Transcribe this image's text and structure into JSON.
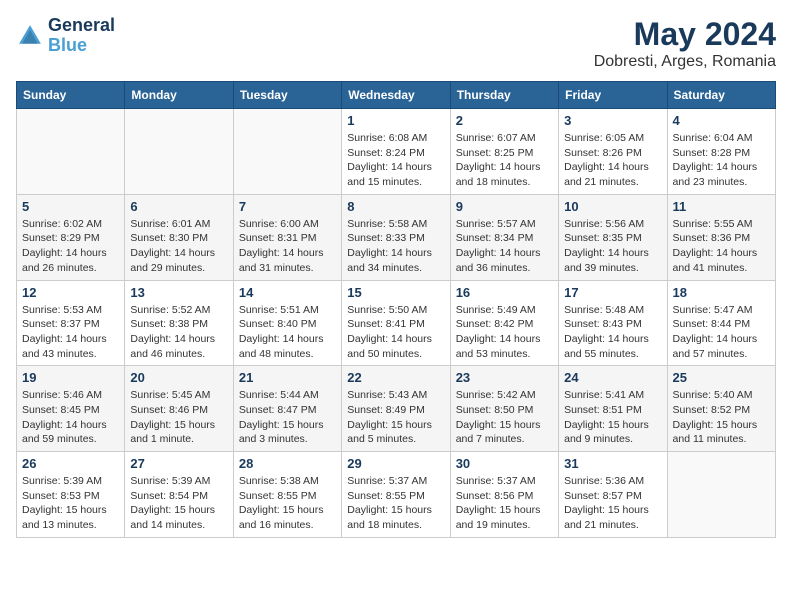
{
  "header": {
    "logo_line1": "General",
    "logo_line2": "Blue",
    "month": "May 2024",
    "location": "Dobresti, Arges, Romania"
  },
  "weekdays": [
    "Sunday",
    "Monday",
    "Tuesday",
    "Wednesday",
    "Thursday",
    "Friday",
    "Saturday"
  ],
  "weeks": [
    [
      {
        "day": "",
        "info": ""
      },
      {
        "day": "",
        "info": ""
      },
      {
        "day": "",
        "info": ""
      },
      {
        "day": "1",
        "info": "Sunrise: 6:08 AM\nSunset: 8:24 PM\nDaylight: 14 hours\nand 15 minutes."
      },
      {
        "day": "2",
        "info": "Sunrise: 6:07 AM\nSunset: 8:25 PM\nDaylight: 14 hours\nand 18 minutes."
      },
      {
        "day": "3",
        "info": "Sunrise: 6:05 AM\nSunset: 8:26 PM\nDaylight: 14 hours\nand 21 minutes."
      },
      {
        "day": "4",
        "info": "Sunrise: 6:04 AM\nSunset: 8:28 PM\nDaylight: 14 hours\nand 23 minutes."
      }
    ],
    [
      {
        "day": "5",
        "info": "Sunrise: 6:02 AM\nSunset: 8:29 PM\nDaylight: 14 hours\nand 26 minutes."
      },
      {
        "day": "6",
        "info": "Sunrise: 6:01 AM\nSunset: 8:30 PM\nDaylight: 14 hours\nand 29 minutes."
      },
      {
        "day": "7",
        "info": "Sunrise: 6:00 AM\nSunset: 8:31 PM\nDaylight: 14 hours\nand 31 minutes."
      },
      {
        "day": "8",
        "info": "Sunrise: 5:58 AM\nSunset: 8:33 PM\nDaylight: 14 hours\nand 34 minutes."
      },
      {
        "day": "9",
        "info": "Sunrise: 5:57 AM\nSunset: 8:34 PM\nDaylight: 14 hours\nand 36 minutes."
      },
      {
        "day": "10",
        "info": "Sunrise: 5:56 AM\nSunset: 8:35 PM\nDaylight: 14 hours\nand 39 minutes."
      },
      {
        "day": "11",
        "info": "Sunrise: 5:55 AM\nSunset: 8:36 PM\nDaylight: 14 hours\nand 41 minutes."
      }
    ],
    [
      {
        "day": "12",
        "info": "Sunrise: 5:53 AM\nSunset: 8:37 PM\nDaylight: 14 hours\nand 43 minutes."
      },
      {
        "day": "13",
        "info": "Sunrise: 5:52 AM\nSunset: 8:38 PM\nDaylight: 14 hours\nand 46 minutes."
      },
      {
        "day": "14",
        "info": "Sunrise: 5:51 AM\nSunset: 8:40 PM\nDaylight: 14 hours\nand 48 minutes."
      },
      {
        "day": "15",
        "info": "Sunrise: 5:50 AM\nSunset: 8:41 PM\nDaylight: 14 hours\nand 50 minutes."
      },
      {
        "day": "16",
        "info": "Sunrise: 5:49 AM\nSunset: 8:42 PM\nDaylight: 14 hours\nand 53 minutes."
      },
      {
        "day": "17",
        "info": "Sunrise: 5:48 AM\nSunset: 8:43 PM\nDaylight: 14 hours\nand 55 minutes."
      },
      {
        "day": "18",
        "info": "Sunrise: 5:47 AM\nSunset: 8:44 PM\nDaylight: 14 hours\nand 57 minutes."
      }
    ],
    [
      {
        "day": "19",
        "info": "Sunrise: 5:46 AM\nSunset: 8:45 PM\nDaylight: 14 hours\nand 59 minutes."
      },
      {
        "day": "20",
        "info": "Sunrise: 5:45 AM\nSunset: 8:46 PM\nDaylight: 15 hours\nand 1 minute."
      },
      {
        "day": "21",
        "info": "Sunrise: 5:44 AM\nSunset: 8:47 PM\nDaylight: 15 hours\nand 3 minutes."
      },
      {
        "day": "22",
        "info": "Sunrise: 5:43 AM\nSunset: 8:49 PM\nDaylight: 15 hours\nand 5 minutes."
      },
      {
        "day": "23",
        "info": "Sunrise: 5:42 AM\nSunset: 8:50 PM\nDaylight: 15 hours\nand 7 minutes."
      },
      {
        "day": "24",
        "info": "Sunrise: 5:41 AM\nSunset: 8:51 PM\nDaylight: 15 hours\nand 9 minutes."
      },
      {
        "day": "25",
        "info": "Sunrise: 5:40 AM\nSunset: 8:52 PM\nDaylight: 15 hours\nand 11 minutes."
      }
    ],
    [
      {
        "day": "26",
        "info": "Sunrise: 5:39 AM\nSunset: 8:53 PM\nDaylight: 15 hours\nand 13 minutes."
      },
      {
        "day": "27",
        "info": "Sunrise: 5:39 AM\nSunset: 8:54 PM\nDaylight: 15 hours\nand 14 minutes."
      },
      {
        "day": "28",
        "info": "Sunrise: 5:38 AM\nSunset: 8:55 PM\nDaylight: 15 hours\nand 16 minutes."
      },
      {
        "day": "29",
        "info": "Sunrise: 5:37 AM\nSunset: 8:55 PM\nDaylight: 15 hours\nand 18 minutes."
      },
      {
        "day": "30",
        "info": "Sunrise: 5:37 AM\nSunset: 8:56 PM\nDaylight: 15 hours\nand 19 minutes."
      },
      {
        "day": "31",
        "info": "Sunrise: 5:36 AM\nSunset: 8:57 PM\nDaylight: 15 hours\nand 21 minutes."
      },
      {
        "day": "",
        "info": ""
      }
    ]
  ]
}
